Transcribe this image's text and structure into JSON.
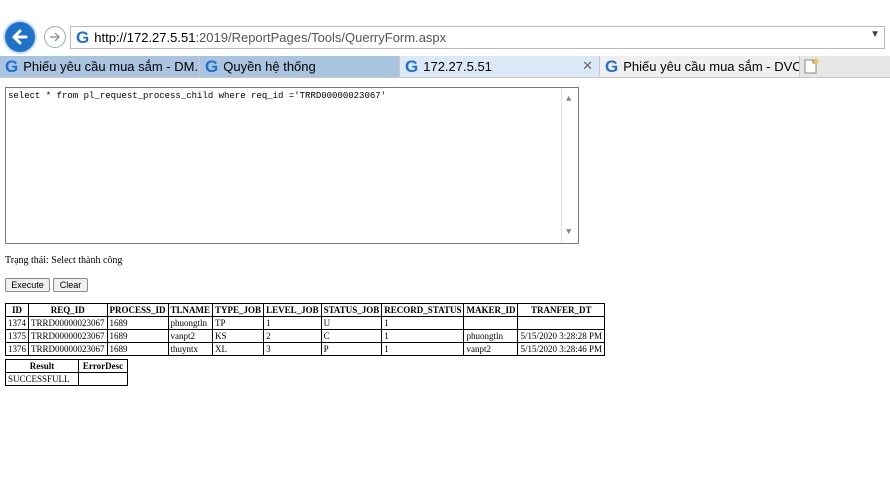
{
  "browser": {
    "url_host": "http://172.27.5.51",
    "url_rest": ":2019/ReportPages/Tools/QuerryForm.aspx",
    "tabs": [
      {
        "label": "Phiếu yêu cầu mua sắm - DM...",
        "state": "inactive"
      },
      {
        "label": "Quyền hệ thống",
        "state": "inactive"
      },
      {
        "label": "172.27.5.51",
        "state": "active"
      },
      {
        "label": "Phiếu yêu cầu mua sắm - DVCM",
        "state": "other"
      }
    ],
    "favicon_letter": "G",
    "close_glyph": "✕"
  },
  "query": {
    "text": "select * from pl_request_process_child where req_id ='TRRD00000023067'"
  },
  "status": {
    "text": "Trạng thái: Select thành công"
  },
  "buttons": {
    "execute": "Execute",
    "clear": "Clear"
  },
  "result_table": {
    "headers": [
      "ID",
      "REQ_ID",
      "PROCESS_ID",
      "TLNAME",
      "TYPE_JOB",
      "LEVEL_JOB",
      "STATUS_JOB",
      "RECORD_STATUS",
      "MAKER_ID",
      "TRANFER_DT"
    ],
    "rows": [
      [
        "1374",
        "TRRD00000023067",
        "1689",
        "phuongtln",
        "TP",
        "1",
        "U",
        "1",
        "",
        ""
      ],
      [
        "1375",
        "TRRD00000023067",
        "1689",
        "vanpt2",
        "KS",
        "2",
        "C",
        "1",
        "phuongtln",
        "5/15/2020 3:28:28 PM"
      ],
      [
        "1376",
        "TRRD00000023067",
        "1689",
        "thuyntx",
        "XL",
        "3",
        "P",
        "1",
        "vanpt2",
        "5/15/2020 3:28:46 PM"
      ]
    ]
  },
  "summary_table": {
    "headers": [
      "Result",
      "ErrorDesc"
    ],
    "rows": [
      [
        "SUCCESSFULL",
        ""
      ]
    ]
  },
  "colors": {
    "accent": "#1e73c9",
    "tab_inactive": "#a8c4e0",
    "tab_active": "#dbe8f6"
  }
}
